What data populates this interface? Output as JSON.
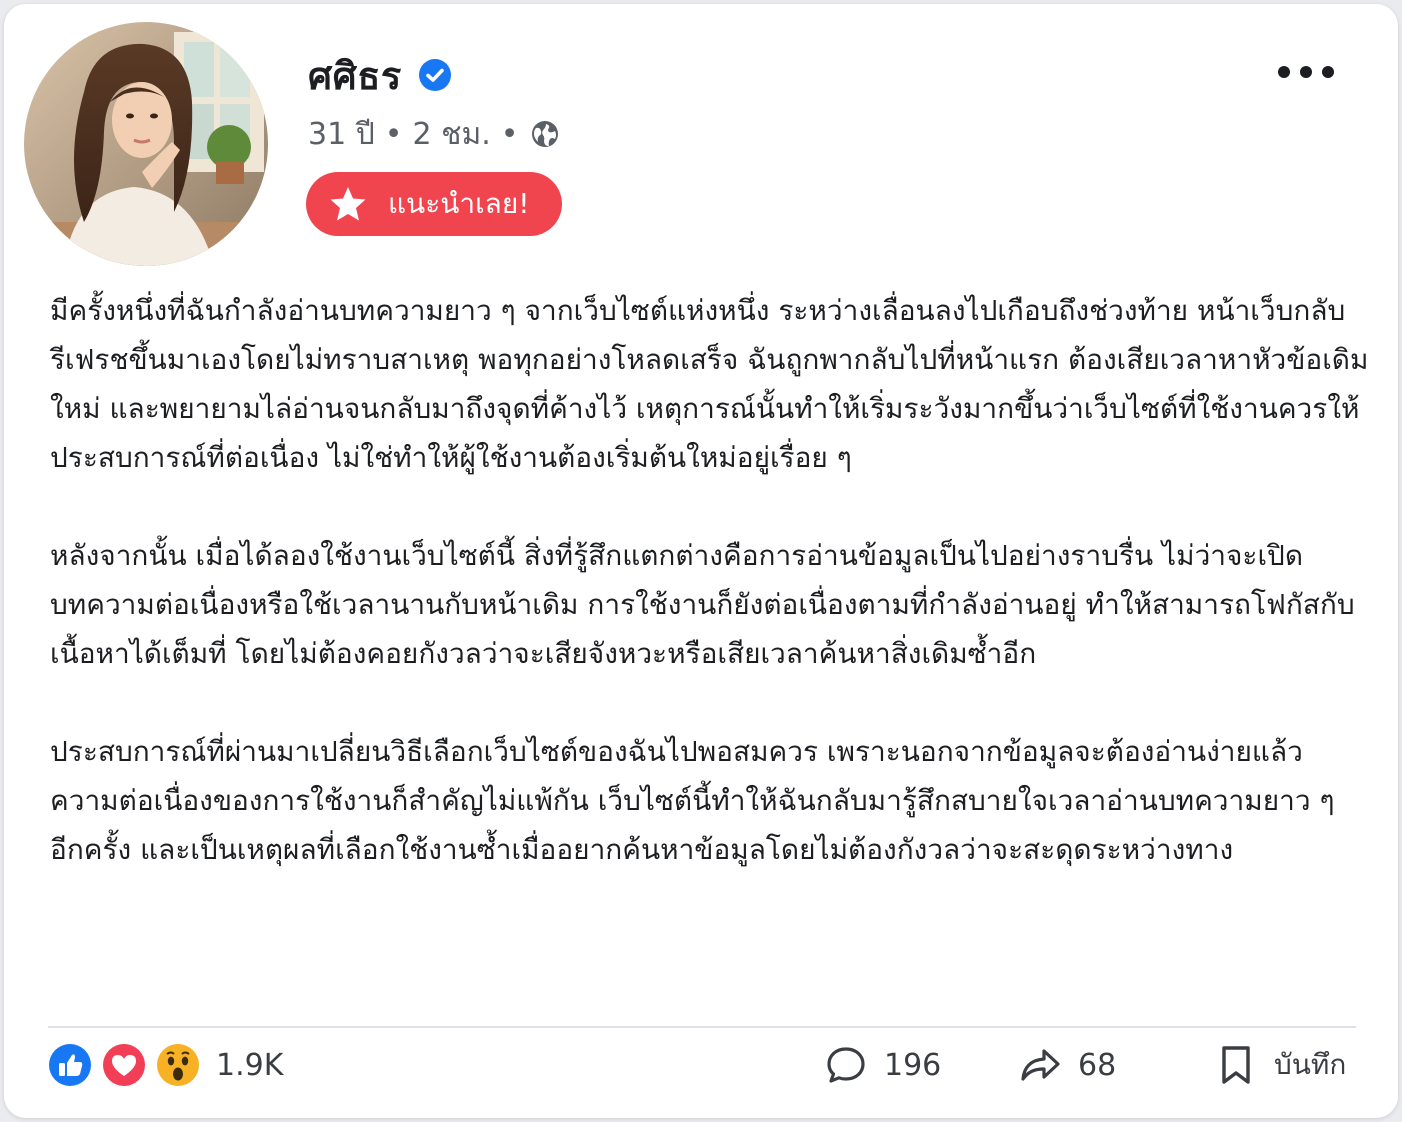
{
  "post": {
    "author": "ศศิธร",
    "age": "31 ปี",
    "time": "2 ชม.",
    "separator": "•",
    "recommend_label": "แนะนำเลย!",
    "paragraphs": [
      "มีครั้งหนึ่งที่ฉันกำลังอ่านบทความยาว ๆ จากเว็บไซต์แห่งหนึ่ง ระหว่างเลื่อนลงไปเกือบถึงช่วงท้าย หน้าเว็บกลับรีเฟรชขึ้นมาเองโดยไม่ทราบสาเหตุ พอทุกอย่างโหลดเสร็จ ฉันถูกพากลับไปที่หน้าแรก ต้องเสียเวลาหาหัวข้อเดิมใหม่ และพยายามไล่อ่านจนกลับมาถึงจุดที่ค้างไว้ เหตุการณ์นั้นทำให้เริ่มระวังมากขึ้นว่าเว็บไซต์ที่ใช้งานควรให้ประสบการณ์ที่ต่อเนื่อง ไม่ใช่ทำให้ผู้ใช้งานต้องเริ่มต้นใหม่อยู่เรื่อย ๆ",
      "หลังจากนั้น เมื่อได้ลองใช้งานเว็บไซต์นี้ สิ่งที่รู้สึกแตกต่างคือการอ่านข้อมูลเป็นไปอย่างราบรื่น ไม่ว่าจะเปิดบทความต่อเนื่องหรือใช้เวลานานกับหน้าเดิม การใช้งานก็ยังต่อเนื่องตามที่กำลังอ่านอยู่ ทำให้สามารถโฟกัสกับเนื้อหาได้เต็มที่ โดยไม่ต้องคอยกังวลว่าจะเสียจังหวะหรือเสียเวลาค้นหาสิ่งเดิมซ้ำอีก",
      "ประสบการณ์ที่ผ่านมาเปลี่ยนวิธีเลือกเว็บไซต์ของฉันไปพอสมควร เพราะนอกจากข้อมูลจะต้องอ่านง่ายแล้ว ความต่อเนื่องของการใช้งานก็สำคัญไม่แพ้กัน เว็บไซต์นี้ทำให้ฉันกลับมารู้สึกสบายใจเวลาอ่านบทความยาว ๆ อีกครั้ง และเป็นเหตุผลที่เลือกใช้งานซ้ำเมื่ออยากค้นหาข้อมูลโดยไม่ต้องกังวลว่าจะสะดุดระหว่างทาง"
    ]
  },
  "stats": {
    "reactions_count": "1.9K",
    "comments_count": "196",
    "shares_count": "68",
    "save_label": "บันทึก"
  },
  "icons": {
    "like": "like-icon",
    "love": "love-icon",
    "wow": "wow-icon",
    "comment": "comment-icon",
    "share": "share-icon",
    "save": "bookmark-icon",
    "verified": "verified-badge-icon",
    "globe": "globe-icon",
    "star": "star-icon",
    "more": "more-dots-icon"
  },
  "colors": {
    "verified": "#1877f2",
    "recommend_bg": "#f0454f",
    "like": "#1877f2",
    "love": "#f33e58",
    "wow": "#f7b125"
  }
}
